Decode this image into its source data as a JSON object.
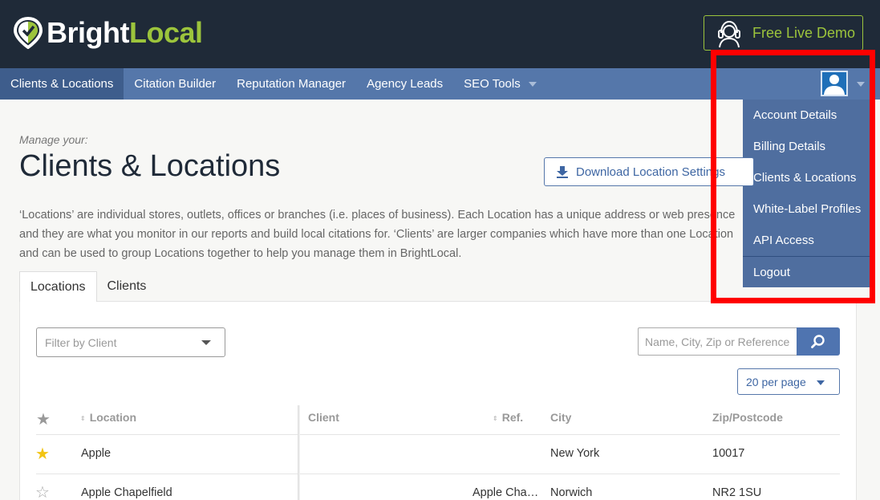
{
  "brand": {
    "name_part1": "Bright",
    "name_part2": "Local",
    "accent_color": "#9cc43c",
    "header_bg": "#1f2a38"
  },
  "header": {
    "demo_button_label": "Free Live Demo",
    "demo_icon": "headset-icon"
  },
  "nav": {
    "items": [
      {
        "label": "Clients & Locations",
        "active": true
      },
      {
        "label": "Citation Builder"
      },
      {
        "label": "Reputation Manager"
      },
      {
        "label": "Agency Leads"
      },
      {
        "label": "SEO Tools",
        "has_caret": true
      }
    ],
    "user_icon": "user-avatar-icon"
  },
  "account_menu": {
    "items": [
      "Account Details",
      "Billing Details",
      "Clients & Locations",
      "White-Label Profiles",
      "API Access"
    ],
    "logout": "Logout"
  },
  "page": {
    "kicker": "Manage your:",
    "title": "Clients & Locations",
    "download_button": "Download Location Settings",
    "description": "‘Locations’ are individual stores, outlets, offices or branches (i.e. places of business). Each Location has a unique address or web presence and they are what you monitor in our reports and build local citations for. ‘Clients’ are larger companies which have more than one Location and can be used to group Locations together to help you manage them in BrightLocal."
  },
  "tabs": [
    {
      "label": "Locations",
      "active": true
    },
    {
      "label": "Clients"
    }
  ],
  "filters": {
    "client_filter_placeholder": "Filter by Client",
    "search_placeholder": "Name, City, Zip or Reference",
    "per_page": "20 per page"
  },
  "table": {
    "columns": {
      "location": "Location",
      "client": "Client",
      "ref": "Ref.",
      "city": "City",
      "zip": "Zip/Postcode"
    },
    "rows": [
      {
        "starred": true,
        "location": "Apple",
        "client": "",
        "ref": "",
        "city": "New York",
        "zip": "10017"
      },
      {
        "starred": false,
        "location": "Apple Chapelfield",
        "client": "",
        "ref": "Apple Cha…",
        "city": "Norwich",
        "zip": "NR2 1SU"
      }
    ]
  },
  "highlight_color": "#ff0000"
}
